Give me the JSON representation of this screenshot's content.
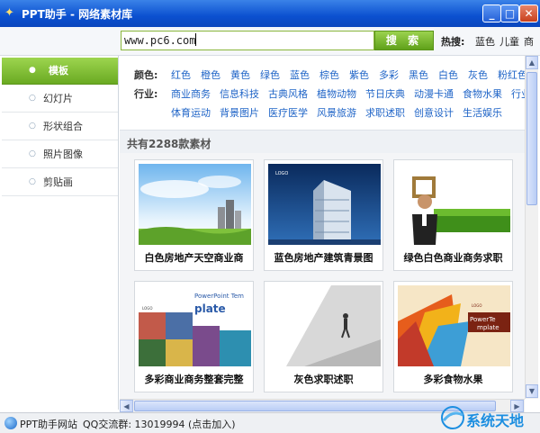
{
  "window": {
    "title": "PPT助手 - 网络素材库",
    "app_icon": "✦",
    "minimize_icon": "_",
    "maximize_icon": "□",
    "close_icon": "✕"
  },
  "search": {
    "value": "www.pc6.com",
    "button_label": "搜 索",
    "hot_label": "热搜:",
    "hot_items": [
      "蓝色",
      "儿童",
      "商"
    ]
  },
  "sidebar": {
    "items": [
      {
        "label": "模板",
        "active": true
      },
      {
        "label": "幻灯片",
        "active": false
      },
      {
        "label": "形状组合",
        "active": false
      },
      {
        "label": "照片图像",
        "active": false
      },
      {
        "label": "剪贴画",
        "active": false
      }
    ]
  },
  "filters": {
    "color_label": "颜色:",
    "colors": [
      "红色",
      "橙色",
      "黄色",
      "绿色",
      "蓝色",
      "棕色",
      "紫色",
      "多彩",
      "黑色",
      "白色",
      "灰色",
      "粉红色"
    ],
    "industry_label": "行业:",
    "industries": [
      "商业商务",
      "信息科技",
      "古典风格",
      "植物动物",
      "节日庆典",
      "动漫卡通",
      "食物水果",
      "行业",
      "体育运动",
      "背景图片",
      "医疗医学",
      "风景旅游",
      "求职述职",
      "创意设计",
      "生活娱乐"
    ]
  },
  "results": {
    "count_text": "共有2288款素材",
    "items": [
      {
        "caption": "白色房地产天空商业商"
      },
      {
        "caption": "蓝色房地产建筑青景图",
        "thumb_text": "LOGO"
      },
      {
        "caption": "绿色白色商业商务求职"
      },
      {
        "caption": "多彩商业商务整套完整",
        "thumb_text": "PowerPoint Tem",
        "thumb_sub": "plate",
        "thumb_logo": "LOGO"
      },
      {
        "caption": "灰色求职述职"
      },
      {
        "caption": "多彩食物水果",
        "thumb_text": "PowerTe",
        "thumb_sub": "mplate",
        "thumb_logo": "LOGO"
      }
    ]
  },
  "status": {
    "site_label": "PPT助手网站",
    "qq_label": "QQ交流群: 13019994 (点击加入)"
  },
  "watermark": {
    "text": "系统天地"
  },
  "colors": {
    "title_bar": "#0b50d0",
    "accent_green": "#6aaa22",
    "link_blue": "#1f64c7"
  }
}
